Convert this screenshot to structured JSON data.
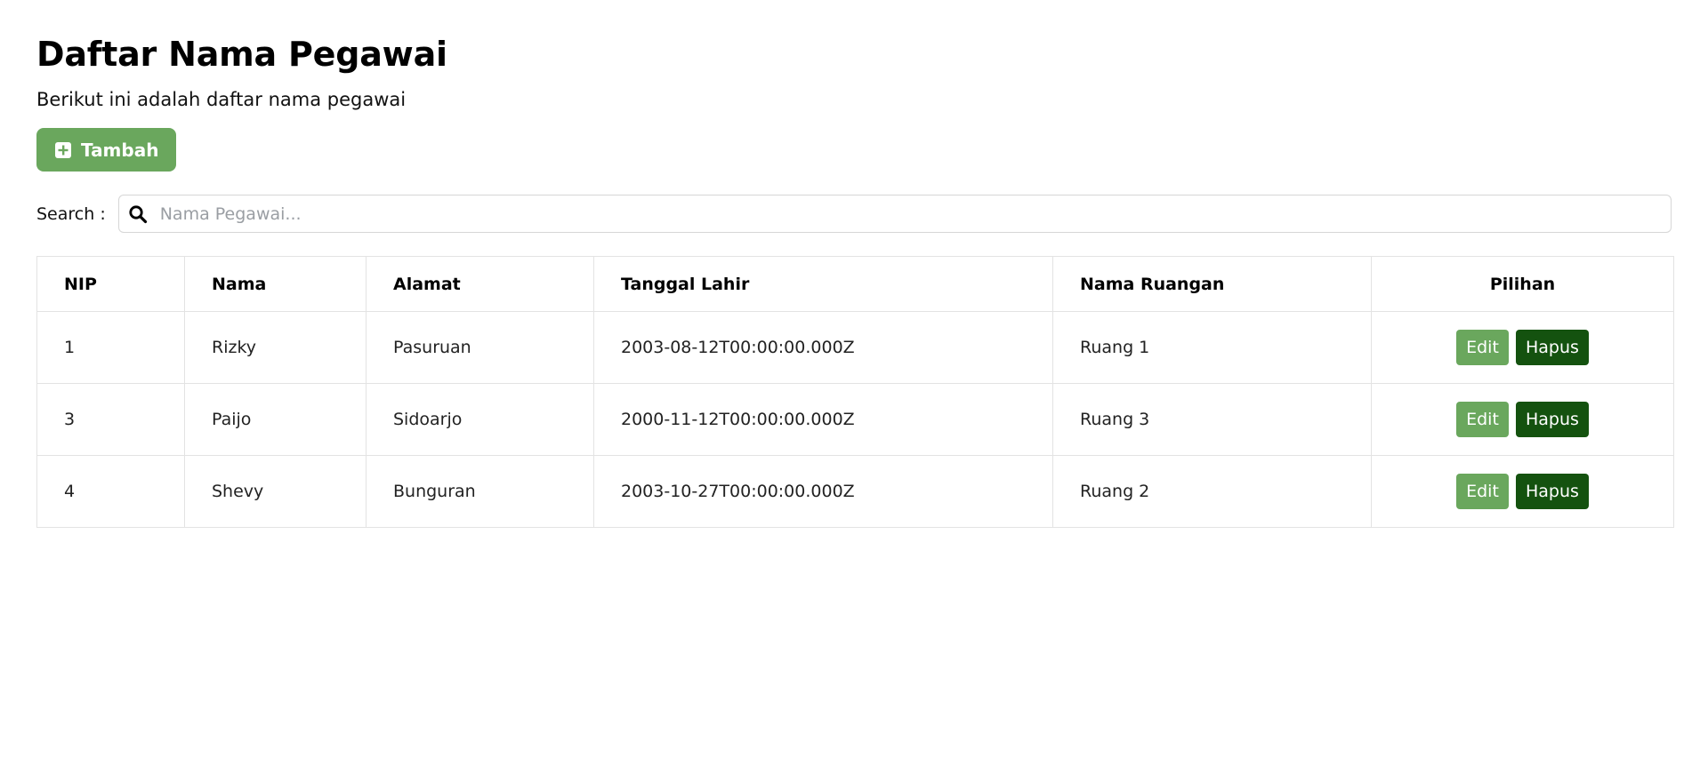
{
  "header": {
    "title": "Daftar Nama Pegawai",
    "subtitle": "Berikut ini adalah daftar nama pegawai"
  },
  "toolbar": {
    "add_label": "Tambah",
    "add_icon": "plus-square-icon"
  },
  "search": {
    "label": "Search :",
    "placeholder": "Nama Pegawai...",
    "value": "",
    "icon": "search-icon"
  },
  "table": {
    "columns": [
      "NIP",
      "Nama",
      "Alamat",
      "Tanggal Lahir",
      "Nama Ruangan",
      "Pilihan"
    ],
    "rows": [
      {
        "nip": "1",
        "nama": "Rizky",
        "alamat": "Pasuruan",
        "tanggal_lahir": "2003-08-12T00:00:00.000Z",
        "ruangan": "Ruang 1"
      },
      {
        "nip": "3",
        "nama": "Paijo",
        "alamat": "Sidoarjo",
        "tanggal_lahir": "2000-11-12T00:00:00.000Z",
        "ruangan": "Ruang 3"
      },
      {
        "nip": "4",
        "nama": "Shevy",
        "alamat": "Bunguran",
        "tanggal_lahir": "2003-10-27T00:00:00.000Z",
        "ruangan": "Ruang 2"
      }
    ],
    "edit_label": "Edit",
    "delete_label": "Hapus"
  },
  "colors": {
    "accent_green": "#6aa75d",
    "dark_green": "#14520f"
  }
}
